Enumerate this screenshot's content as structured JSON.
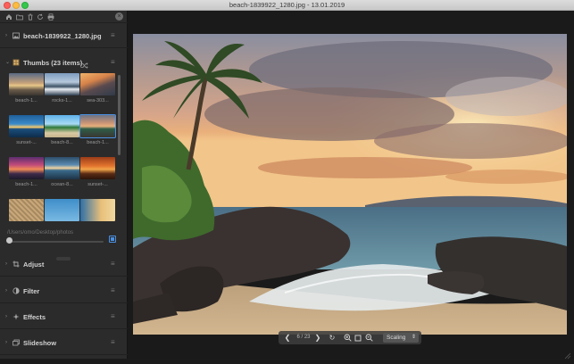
{
  "window": {
    "title": "beach-1839922_1280.jpg - 13.01.2019"
  },
  "toolbar": {
    "icons": [
      "home-icon",
      "folder-icon",
      "trash-icon",
      "refresh-icon",
      "print-icon"
    ],
    "close_icon": "×"
  },
  "sidebar": {
    "file_section": {
      "label": "beach-1839922_1280.jpg",
      "chevron": "›"
    },
    "thumbs_section": {
      "label": "Thumbs (23 items)",
      "chevron": "⌄"
    },
    "thumbs": [
      {
        "caption": "beach-1..."
      },
      {
        "caption": "rocks-1..."
      },
      {
        "caption": "sea-303..."
      },
      {
        "caption": "sunset-..."
      },
      {
        "caption": "beach-8..."
      },
      {
        "caption": "beach-1..."
      },
      {
        "caption": "beach-1..."
      },
      {
        "caption": "ocean-8..."
      },
      {
        "caption": "sunset-..."
      }
    ],
    "path": "/Users/omo/Desktop/photos",
    "sections": [
      {
        "label": "Adjust",
        "chevron": "›"
      },
      {
        "label": "Filter",
        "chevron": "›"
      },
      {
        "label": "Effects",
        "chevron": "›"
      },
      {
        "label": "Slideshow",
        "chevron": "›"
      }
    ],
    "menu_icon": "≡",
    "thumb_size": 0.03
  },
  "hud": {
    "prev": "❮",
    "counter": "6 / 23",
    "next": "❯",
    "rotate": "↻",
    "zoom_in": "+",
    "fit": "□",
    "zoom_out": "−",
    "scaling_label": "Scaling",
    "scaling_arrow": "⇕"
  },
  "colors": {
    "accent": "#4a90e2",
    "sidebar_bg": "#2b2b2b",
    "viewer_bg": "#1a1a1a"
  }
}
